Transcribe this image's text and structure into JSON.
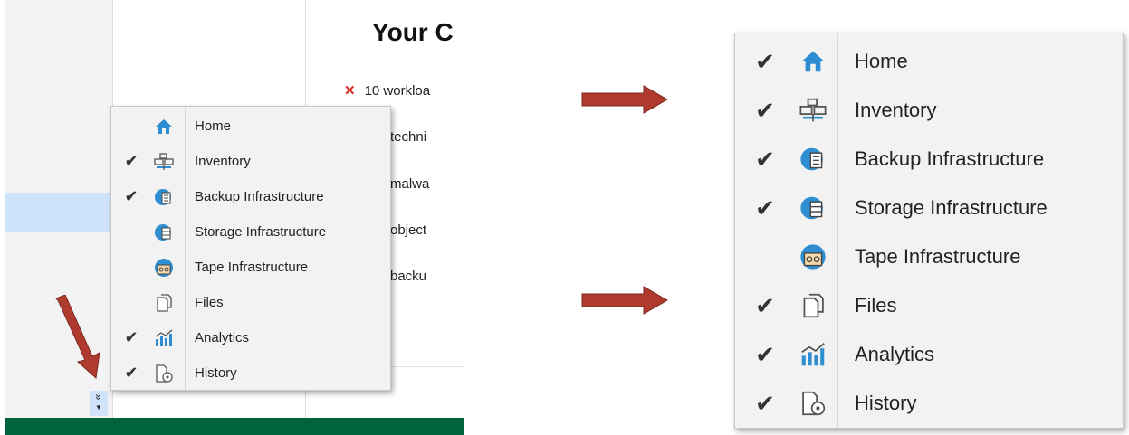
{
  "left_panel": {
    "heading": "Your C",
    "rows": [
      {
        "mark": "✕",
        "text": "10 workloa"
      },
      {
        "mark": "",
        "text": "IO techni"
      },
      {
        "mark": "",
        "text": "IO malwa"
      },
      {
        "mark": "",
        "text": "IO object"
      },
      {
        "mark": "",
        "text": "IO backu"
      }
    ],
    "overflow_button": "»"
  },
  "menu_small": {
    "items": [
      {
        "label": "Home",
        "checked": false,
        "icon": "home-icon"
      },
      {
        "label": "Inventory",
        "checked": true,
        "icon": "inventory-icon"
      },
      {
        "label": "Backup Infrastructure",
        "checked": true,
        "icon": "backup-infrastructure-icon"
      },
      {
        "label": "Storage Infrastructure",
        "checked": false,
        "icon": "storage-infrastructure-icon"
      },
      {
        "label": "Tape Infrastructure",
        "checked": false,
        "icon": "tape-infrastructure-icon"
      },
      {
        "label": "Files",
        "checked": false,
        "icon": "files-icon"
      },
      {
        "label": "Analytics",
        "checked": true,
        "icon": "analytics-icon"
      },
      {
        "label": "History",
        "checked": true,
        "icon": "history-icon"
      }
    ]
  },
  "menu_large": {
    "items": [
      {
        "label": "Home",
        "checked": true,
        "icon": "home-icon"
      },
      {
        "label": "Inventory",
        "checked": true,
        "icon": "inventory-icon"
      },
      {
        "label": "Backup Infrastructure",
        "checked": true,
        "icon": "backup-infrastructure-icon"
      },
      {
        "label": "Storage Infrastructure",
        "checked": true,
        "icon": "storage-infrastructure-icon"
      },
      {
        "label": "Tape Infrastructure",
        "checked": false,
        "icon": "tape-infrastructure-icon"
      },
      {
        "label": "Files",
        "checked": true,
        "icon": "files-icon"
      },
      {
        "label": "Analytics",
        "checked": true,
        "icon": "analytics-icon"
      },
      {
        "label": "History",
        "checked": true,
        "icon": "history-icon"
      }
    ]
  },
  "colors": {
    "arrow": "#b03a2e",
    "footer": "#00633b",
    "selection": "#cfe3fa",
    "icon_blue": "#2f8ed1"
  },
  "check_glyph": "✔"
}
